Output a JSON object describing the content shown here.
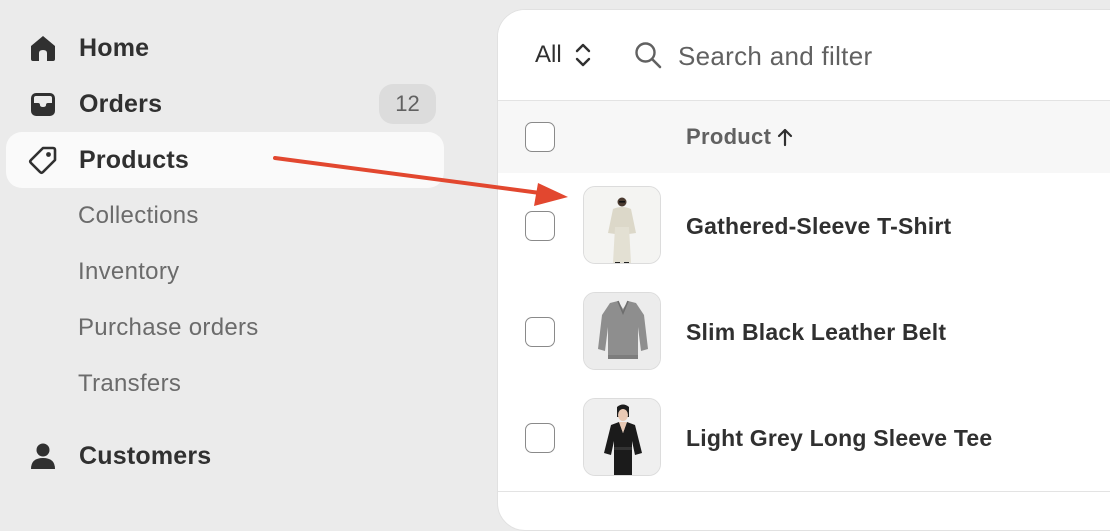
{
  "sidebar": {
    "home": "Home",
    "orders": "Orders",
    "orders_count": "12",
    "products": "Products",
    "sub_items": [
      "Collections",
      "Inventory",
      "Purchase orders",
      "Transfers"
    ],
    "customers": "Customers"
  },
  "toolbar": {
    "filter_label": "All",
    "search_placeholder": "Search and filter"
  },
  "table": {
    "column_product": "Product",
    "rows": [
      {
        "title": "Gathered-Sleeve T-Shirt"
      },
      {
        "title": "Slim Black Leather Belt"
      },
      {
        "title": "Light Grey Long Sleeve Tee"
      }
    ]
  },
  "colors": {
    "sidebar_bg": "#ebebeb",
    "active_item_bg": "#fafafa",
    "annotation_arrow": "#e2472f"
  },
  "icons": [
    "home-icon",
    "orders-icon",
    "tag-icon",
    "person-icon",
    "search-icon",
    "chevron-updown-icon",
    "arrow-up-icon"
  ]
}
